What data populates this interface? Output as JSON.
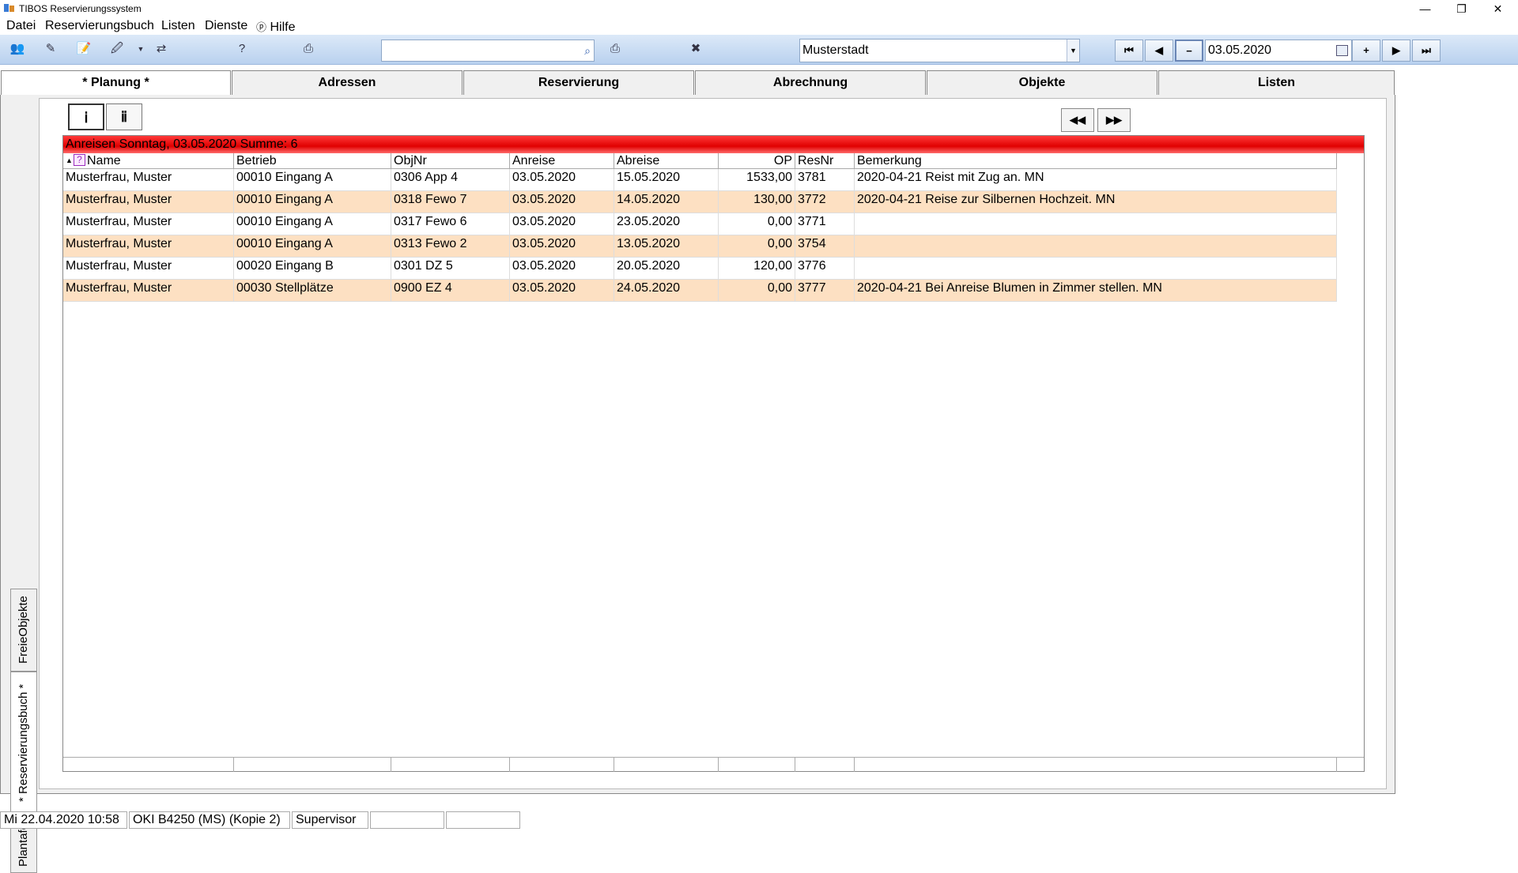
{
  "window": {
    "title": "TIBOS Reservierungssystem",
    "min": "—",
    "restore": "❐",
    "close": "✕"
  },
  "menu": [
    "Datei",
    "Reservierungsbuch",
    "Listen",
    "Dienste",
    "Hilfe"
  ],
  "toolbar": {
    "search_value": "",
    "city": "Musterstadt",
    "date": "03.05.2020",
    "nav": {
      "first": "⏮",
      "prev": "◀",
      "minus": "−",
      "plus": "+",
      "next": "▶",
      "last": "⏭"
    }
  },
  "tabs": [
    "* Planung *",
    "Adressen",
    "Reservierung",
    "Abrechnung",
    "Objekte",
    "Listen"
  ],
  "side_tabs": [
    "FreieObjekte",
    "* Reservierungsbuch *",
    "Plantafel"
  ],
  "grid": {
    "banner": "Anreisen Sonntag, 03.05.2020 Summe: 6",
    "columns": [
      "Name",
      "Betrieb",
      "ObjNr",
      "Anreise",
      "Abreise",
      "OP",
      "ResNr",
      "Bemerkung"
    ],
    "rows": [
      [
        "Musterfrau, Muster",
        "00010 Eingang A",
        "0306 App 4",
        "03.05.2020",
        "15.05.2020",
        "1533,00",
        "3781",
        "2020-04-21 Reist mit Zug an. MN"
      ],
      [
        "Musterfrau, Muster",
        "00010 Eingang A",
        "0318 Fewo 7",
        "03.05.2020",
        "14.05.2020",
        "130,00",
        "3772",
        "2020-04-21 Reise zur Silbernen Hochzeit. MN"
      ],
      [
        "Musterfrau, Muster",
        "00010 Eingang A",
        "0317 Fewo 6",
        "03.05.2020",
        "23.05.2020",
        "0,00",
        "3771",
        ""
      ],
      [
        "Musterfrau, Muster",
        "00010 Eingang A",
        "0313 Fewo 2",
        "03.05.2020",
        "13.05.2020",
        "0,00",
        "3754",
        ""
      ],
      [
        "Musterfrau, Muster",
        "00020 Eingang B",
        "0301 DZ 5",
        "03.05.2020",
        "20.05.2020",
        "120,00",
        "3776",
        ""
      ],
      [
        "Musterfrau, Muster",
        "00030 Stellplätze",
        "0900 EZ 4",
        "03.05.2020",
        "24.05.2020",
        "0,00",
        "3777",
        "2020-04-21 Bei Anreise Blumen in Zimmer stellen. MN"
      ]
    ]
  },
  "status": [
    "Mi 22.04.2020 10:58",
    "OKI B4250 (MS) (Kopie 2)",
    "Supervisor",
    "",
    ""
  ]
}
